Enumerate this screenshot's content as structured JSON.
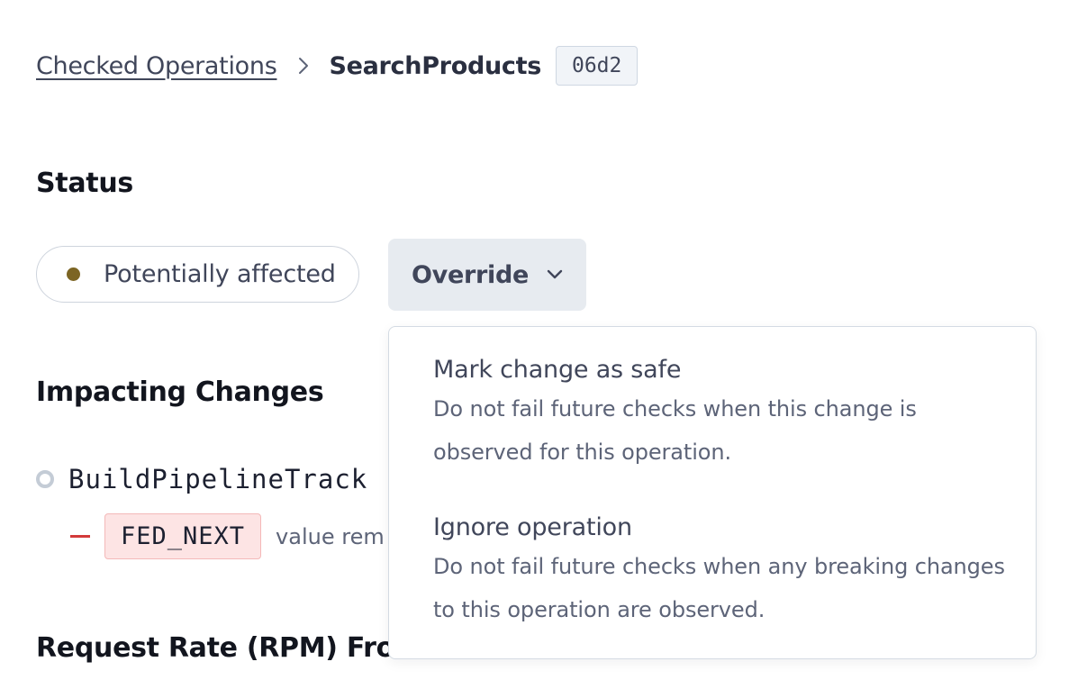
{
  "breadcrumb": {
    "parent_label": "Checked Operations",
    "current_label": "SearchProducts",
    "operation_id": "06d2"
  },
  "status": {
    "heading": "Status",
    "badge_label": "Potentially affected",
    "badge_color": "#7c6523",
    "override_label": "Override"
  },
  "impacting_changes": {
    "heading": "Impacting Changes",
    "change_name": "BuildPipelineTrack",
    "removed_value": "FED_NEXT",
    "removed_note": "value rem"
  },
  "request_rate": {
    "heading": "Request Rate (RPM) From"
  },
  "override_menu": {
    "items": [
      {
        "title": "Mark change as safe",
        "description_line1": "Do not fail future checks when this change is",
        "description_line2": "observed for this operation."
      },
      {
        "title": "Ignore operation",
        "description_line1": "Do not fail future checks when any breaking changes",
        "description_line2": "to this operation are observed."
      }
    ]
  },
  "icons": {
    "breadcrumb_separator": "chevron-right-icon",
    "override_dropdown": "chevron-down-icon"
  }
}
